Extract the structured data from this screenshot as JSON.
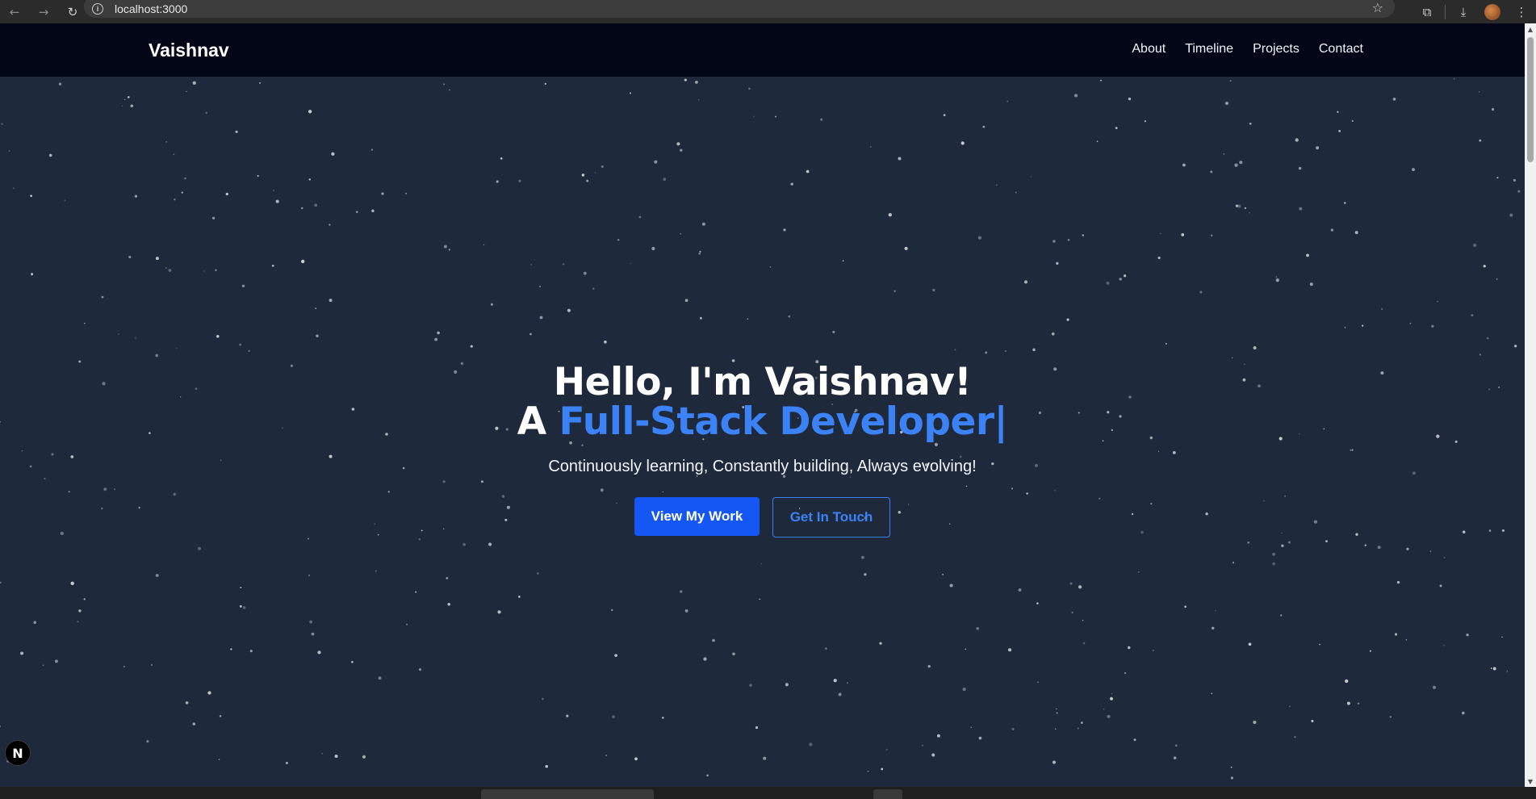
{
  "browser": {
    "back_icon": "back-arrow-icon",
    "forward_icon": "forward-arrow-icon",
    "reload_icon": "reload-icon",
    "url": "localhost:3000"
  },
  "site": {
    "logo": "Vaishnav",
    "nav": [
      "About",
      "Timeline",
      "Projects",
      "Contact"
    ]
  },
  "hero": {
    "greeting": "Hello, I'm Vaishnav!",
    "role_prefix": "A ",
    "role": "Full-Stack Developer",
    "cursor": "|",
    "tagline": "Continuously learning, Constantly building, Always evolving!",
    "primary_cta": "View My Work",
    "secondary_cta": "Get In Touch"
  },
  "dev_badge": "N",
  "colors": {
    "background": "#1e293b",
    "header": "#020617",
    "accent": "#3b82f6",
    "primary_button": "#1557f5"
  }
}
